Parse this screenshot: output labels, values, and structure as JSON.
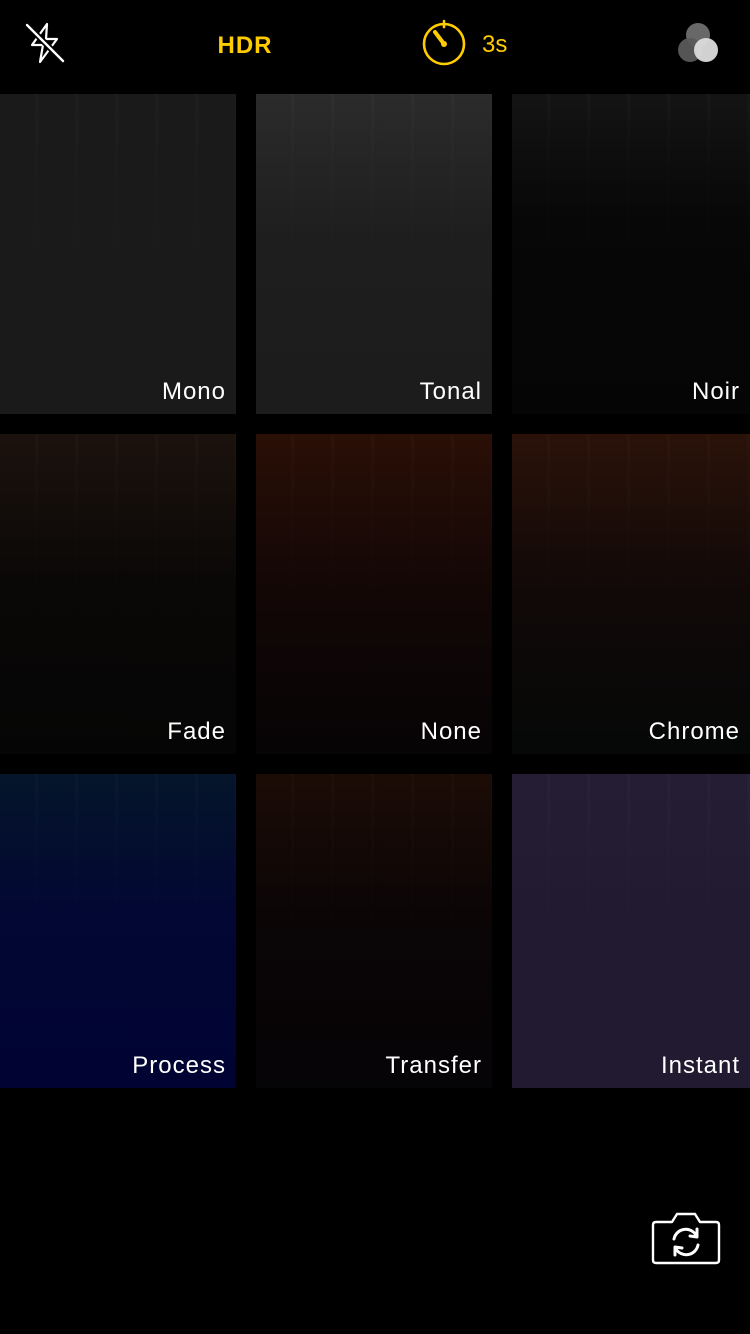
{
  "colors": {
    "accent": "#FFCC00",
    "background": "#000000",
    "label": "#FFFFFF"
  },
  "topbar": {
    "flash_icon": "flash-off-icon",
    "hdr_label": "HDR",
    "timer_icon": "timer-icon",
    "timer_value": "3s",
    "filters_icon": "filters-icon"
  },
  "filters": [
    {
      "name": "Mono"
    },
    {
      "name": "Tonal"
    },
    {
      "name": "Noir"
    },
    {
      "name": "Fade"
    },
    {
      "name": "None"
    },
    {
      "name": "Chrome"
    },
    {
      "name": "Process"
    },
    {
      "name": "Transfer"
    },
    {
      "name": "Instant"
    }
  ],
  "bottom": {
    "switch_camera_icon": "switch-camera-icon"
  }
}
